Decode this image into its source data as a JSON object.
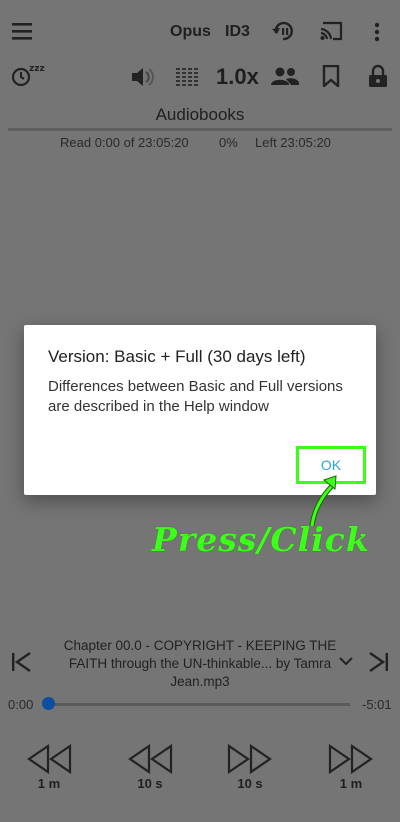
{
  "toolbar": {
    "codec": "Opus",
    "tag": "ID3",
    "speed": "1.0x",
    "icons": [
      "menu-icon",
      "replay-icon",
      "cast-icon",
      "more-vert-icon",
      "sleep-timer-icon",
      "volume-icon",
      "equalizer-icon",
      "people-icon",
      "bookmark-icon",
      "lock-icon"
    ]
  },
  "title": "Audiobooks",
  "progress": {
    "read": "Read 0:00 of 23:05:20",
    "percent": "0%",
    "left": "Left 23:05:20"
  },
  "dialog": {
    "title": "Version: Basic + Full (30 days left)",
    "message": "Differences between Basic and Full versions are described in the Help window",
    "ok_label": "OK"
  },
  "annotation": {
    "text": "Press/Click",
    "color": "#3cff1a"
  },
  "player": {
    "chapter_title": "Chapter 00.0 - COPYRIGHT - KEEPING THE FAITH through the UN-thinkable... by Tamra Jean.mp3",
    "position": "0:00",
    "remaining": "-5:01",
    "position_fraction": 0.0,
    "steps": {
      "back_large": "1 m",
      "back_small": "10 s",
      "fwd_small": "10 s",
      "fwd_large": "1 m"
    }
  },
  "colors": {
    "background": "#757575",
    "ok_text": "#2aa6d8",
    "highlight": "#39ff14",
    "seek_knob": "#0a4fa0"
  }
}
